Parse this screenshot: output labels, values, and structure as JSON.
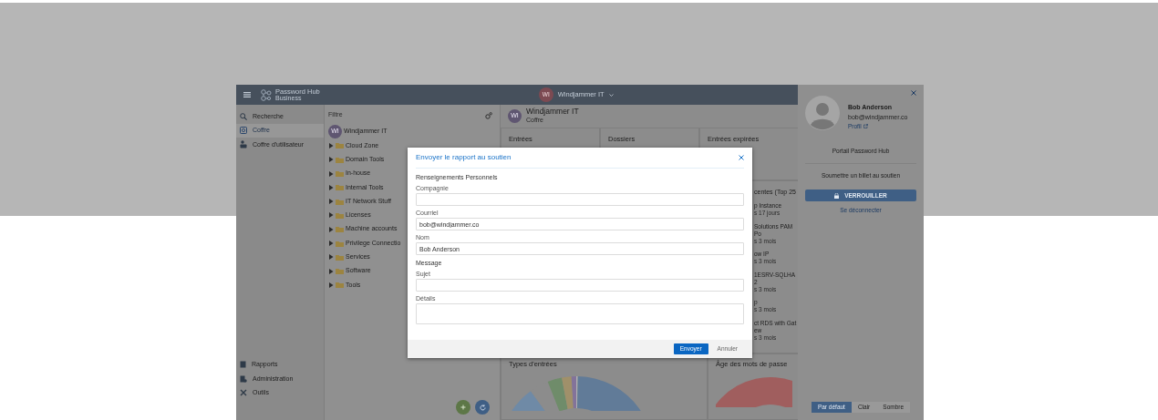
{
  "header": {
    "logo_title": "Password Hub",
    "logo_subtitle": "Business",
    "vault_avatar": "WI",
    "vault_name": "Windjammer IT"
  },
  "sidebar": {
    "items": [
      {
        "label": "Recherche",
        "selected": false
      },
      {
        "label": "Coffre",
        "selected": true
      },
      {
        "label": "Coffre d'utilisateur",
        "selected": false
      }
    ],
    "bottom_items": [
      {
        "label": "Rapports"
      },
      {
        "label": "Administration"
      },
      {
        "label": "Outils"
      }
    ]
  },
  "tree": {
    "filter_placeholder": "Filtre",
    "root": {
      "avatar": "WI",
      "label": "Windjammer IT",
      "children": [
        {
          "label": "Cloud Zone",
          "expanded": false
        },
        {
          "label": "Domain Tools",
          "expanded": false
        },
        {
          "label": "In-house",
          "expanded": false
        },
        {
          "label": "Internal Tools",
          "expanded": false
        },
        {
          "label": "IT Network Stuff",
          "expanded": false
        },
        {
          "label": "Licenses",
          "expanded": false
        },
        {
          "label": "Machine accounts",
          "expanded": false
        },
        {
          "label": "Privilege Connectio",
          "expanded": false
        },
        {
          "label": "Services",
          "expanded": false
        },
        {
          "label": "Software",
          "expanded": false
        },
        {
          "label": "Tools",
          "expanded": false
        }
      ]
    }
  },
  "dashboard": {
    "vault_avatar": "WI",
    "title": "Windjammer IT",
    "subtitle": "Coffre",
    "tiles": [
      "Entrées",
      "Dossiers",
      "Entrées expirées"
    ],
    "recent": {
      "title": "centes (Top 25",
      "items": [
        {
          "name": "p Instance",
          "age": "s 17 jours"
        },
        {
          "name": "Solutions PAM Po",
          "age": "s 3 mois"
        },
        {
          "name": "ow IP",
          "age": "s 3 mois"
        },
        {
          "name": "1ESRV-SQLHA2",
          "age": "s 3 mois"
        },
        {
          "name": "p",
          "age": "s 3 mois"
        },
        {
          "name": "ct RDS with Gatew",
          "age": "s 3 mois"
        }
      ]
    },
    "charts": [
      "Types d'entrées",
      "Âge des mots de passe"
    ]
  },
  "modal": {
    "title": "Envoyer le rapport au soutien",
    "sections": [
      {
        "heading": "Renseignements Personnels",
        "fields": [
          {
            "label": "Compagnie",
            "kind": "input"
          },
          {
            "label": "Courriel",
            "kind": "input",
            "value": "bob@windjammer.co"
          },
          {
            "label": "Nom",
            "kind": "input",
            "value": "Bob Anderson"
          }
        ]
      },
      {
        "heading": "Message",
        "fields": [
          {
            "label": "Sujet",
            "kind": "input"
          },
          {
            "label": "Détails",
            "kind": "textarea"
          }
        ]
      }
    ],
    "primary_button": "Envoyer",
    "secondary_button": "Annuler"
  },
  "user_panel": {
    "name": "Bob Anderson",
    "email": "bob@windjammer.co",
    "profile_link": "Profil",
    "links": [
      "Portail Password Hub",
      "Soumettre un billet au soutien"
    ],
    "lock_button": "VERROUILLER",
    "logout": "Se déconnecter",
    "themes": [
      {
        "label": "Par défaut",
        "selected": true
      },
      {
        "label": "Clair",
        "selected": false
      },
      {
        "label": "Sombre",
        "selected": false
      }
    ]
  }
}
